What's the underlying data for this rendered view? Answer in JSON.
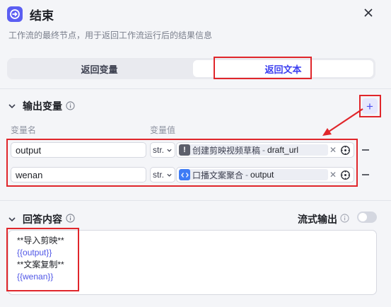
{
  "header": {
    "title": "结束",
    "subtitle": "工作流的最终节点，用于返回工作流运行后的结果信息"
  },
  "tabs": [
    {
      "label": "返回变量",
      "active": false
    },
    {
      "label": "返回文本",
      "active": true
    }
  ],
  "output_section": {
    "title": "输出变量",
    "add_label": "+",
    "col_name": "变量名",
    "col_value": "变量值",
    "rows": [
      {
        "name": "output",
        "type": "str.",
        "ref_node": "创建剪映视频草稿",
        "ref_sep": "-",
        "ref_var": "draft_url",
        "icon": "warning-node-icon",
        "icon_color": "#5c5f6b"
      },
      {
        "name": "wenan",
        "type": "str.",
        "ref_node": "口播文案聚合",
        "ref_sep": "-",
        "ref_var": "output",
        "icon": "code-node-icon",
        "icon_color": "#3f7cf5"
      }
    ]
  },
  "answer_section": {
    "title": "回答内容",
    "stream_label": "流式输出",
    "stream_enabled": false,
    "lines": [
      {
        "text": "**导入剪映**",
        "kind": "plain"
      },
      {
        "text": "{{output}}",
        "kind": "tmpl"
      },
      {
        "text": "**文案复制**",
        "kind": "plain"
      },
      {
        "text": "{{wenan}}",
        "kind": "tmpl"
      }
    ]
  },
  "colors": {
    "accent": "#4b4ef0",
    "annotation": "#e0262b"
  }
}
